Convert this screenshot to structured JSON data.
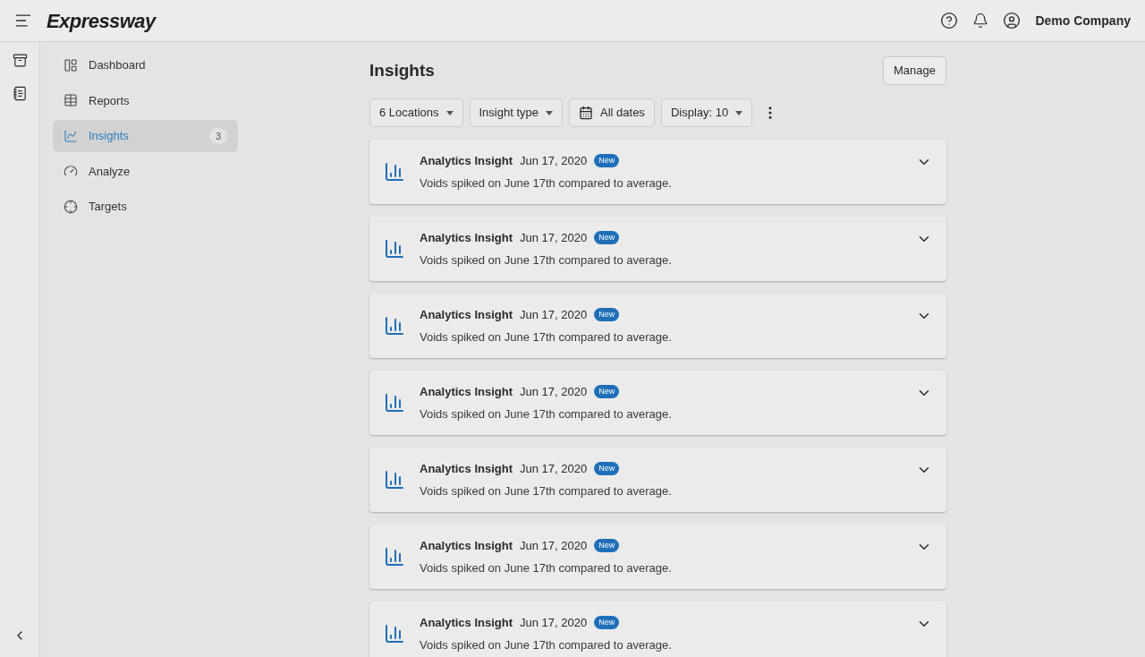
{
  "header": {
    "logo": "Expressway",
    "account": "Demo Company"
  },
  "nav": [
    {
      "label": "Dashboard",
      "selected": false
    },
    {
      "label": "Reports",
      "selected": false
    },
    {
      "label": "Insights",
      "selected": true,
      "badge": "3"
    },
    {
      "label": "Analyze",
      "selected": false
    },
    {
      "label": "Targets",
      "selected": false
    }
  ],
  "page": {
    "title": "Insights",
    "manage_button": "Manage"
  },
  "filters": [
    {
      "label": "6 Locations",
      "kind": "dropdown"
    },
    {
      "label": "Insight type",
      "kind": "dropdown"
    },
    {
      "label": "All dates",
      "kind": "date"
    },
    {
      "label": "Display: 10",
      "kind": "dropdown"
    }
  ],
  "insights": [
    {
      "title": "Analytics Insight",
      "date": "Jun 17, 2020",
      "badge": "New",
      "message": "Voids spiked on June 17th compared to average."
    },
    {
      "title": "Analytics Insight",
      "date": "Jun 17, 2020",
      "badge": "New",
      "message": "Voids spiked on June 17th compared to average."
    },
    {
      "title": "Analytics Insight",
      "date": "Jun 17, 2020",
      "badge": "New",
      "message": "Voids spiked on June 17th compared to average."
    },
    {
      "title": "Analytics Insight",
      "date": "Jun 17, 2020",
      "badge": "New",
      "message": "Voids spiked on June 17th compared to average."
    },
    {
      "title": "Analytics Insight",
      "date": "Jun 17, 2020",
      "badge": "New",
      "message": "Voids spiked on June 17th compared to average."
    },
    {
      "title": "Analytics Insight",
      "date": "Jun 17, 2020",
      "badge": "New",
      "message": "Voids spiked on June 17th compared to average."
    },
    {
      "title": "Analytics Insight",
      "date": "Jun 17, 2020",
      "badge": "New",
      "message": "Voids spiked on June 17th compared to average."
    }
  ]
}
